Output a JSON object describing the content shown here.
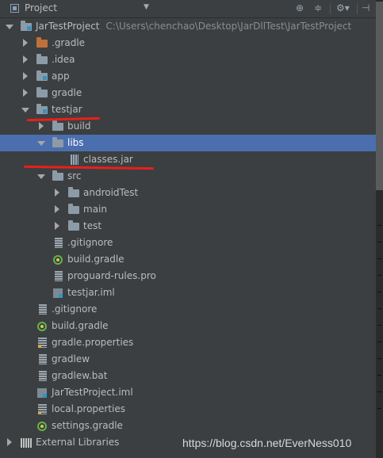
{
  "header": {
    "title": "Project",
    "icons": [
      "project-icon",
      "dropdown-arrow-icon",
      "sync-icon",
      "collapse-all-icon",
      "settings-gear-icon",
      "hide-icon"
    ]
  },
  "tree": {
    "root": {
      "name": "JarTestProject",
      "path": "C:\\Users\\chenchao\\Desktop\\JarDllTest\\JarTestProject"
    },
    "items": [
      {
        "label": ".gradle"
      },
      {
        "label": ".idea"
      },
      {
        "label": "app"
      },
      {
        "label": "gradle"
      },
      {
        "label": "testjar"
      },
      {
        "label": "build"
      },
      {
        "label": "libs"
      },
      {
        "label": "classes.jar"
      },
      {
        "label": "src"
      },
      {
        "label": "androidTest"
      },
      {
        "label": "main"
      },
      {
        "label": "test"
      },
      {
        "label": ".gitignore"
      },
      {
        "label": "build.gradle"
      },
      {
        "label": "proguard-rules.pro"
      },
      {
        "label": "testjar.iml"
      },
      {
        "label": ".gitignore"
      },
      {
        "label": "build.gradle"
      },
      {
        "label": "gradle.properties"
      },
      {
        "label": "gradlew"
      },
      {
        "label": "gradlew.bat"
      },
      {
        "label": "JarTestProject.iml"
      },
      {
        "label": "local.properties"
      },
      {
        "label": "settings.gradle"
      },
      {
        "label": "External Libraries"
      }
    ]
  },
  "colors": {
    "background": "#3c3f41",
    "selection": "#4b6eaf",
    "annotation": "#e8201b",
    "folder": "#8d9ba7"
  },
  "watermark": "https://blog.csdn.net/EverNess010"
}
